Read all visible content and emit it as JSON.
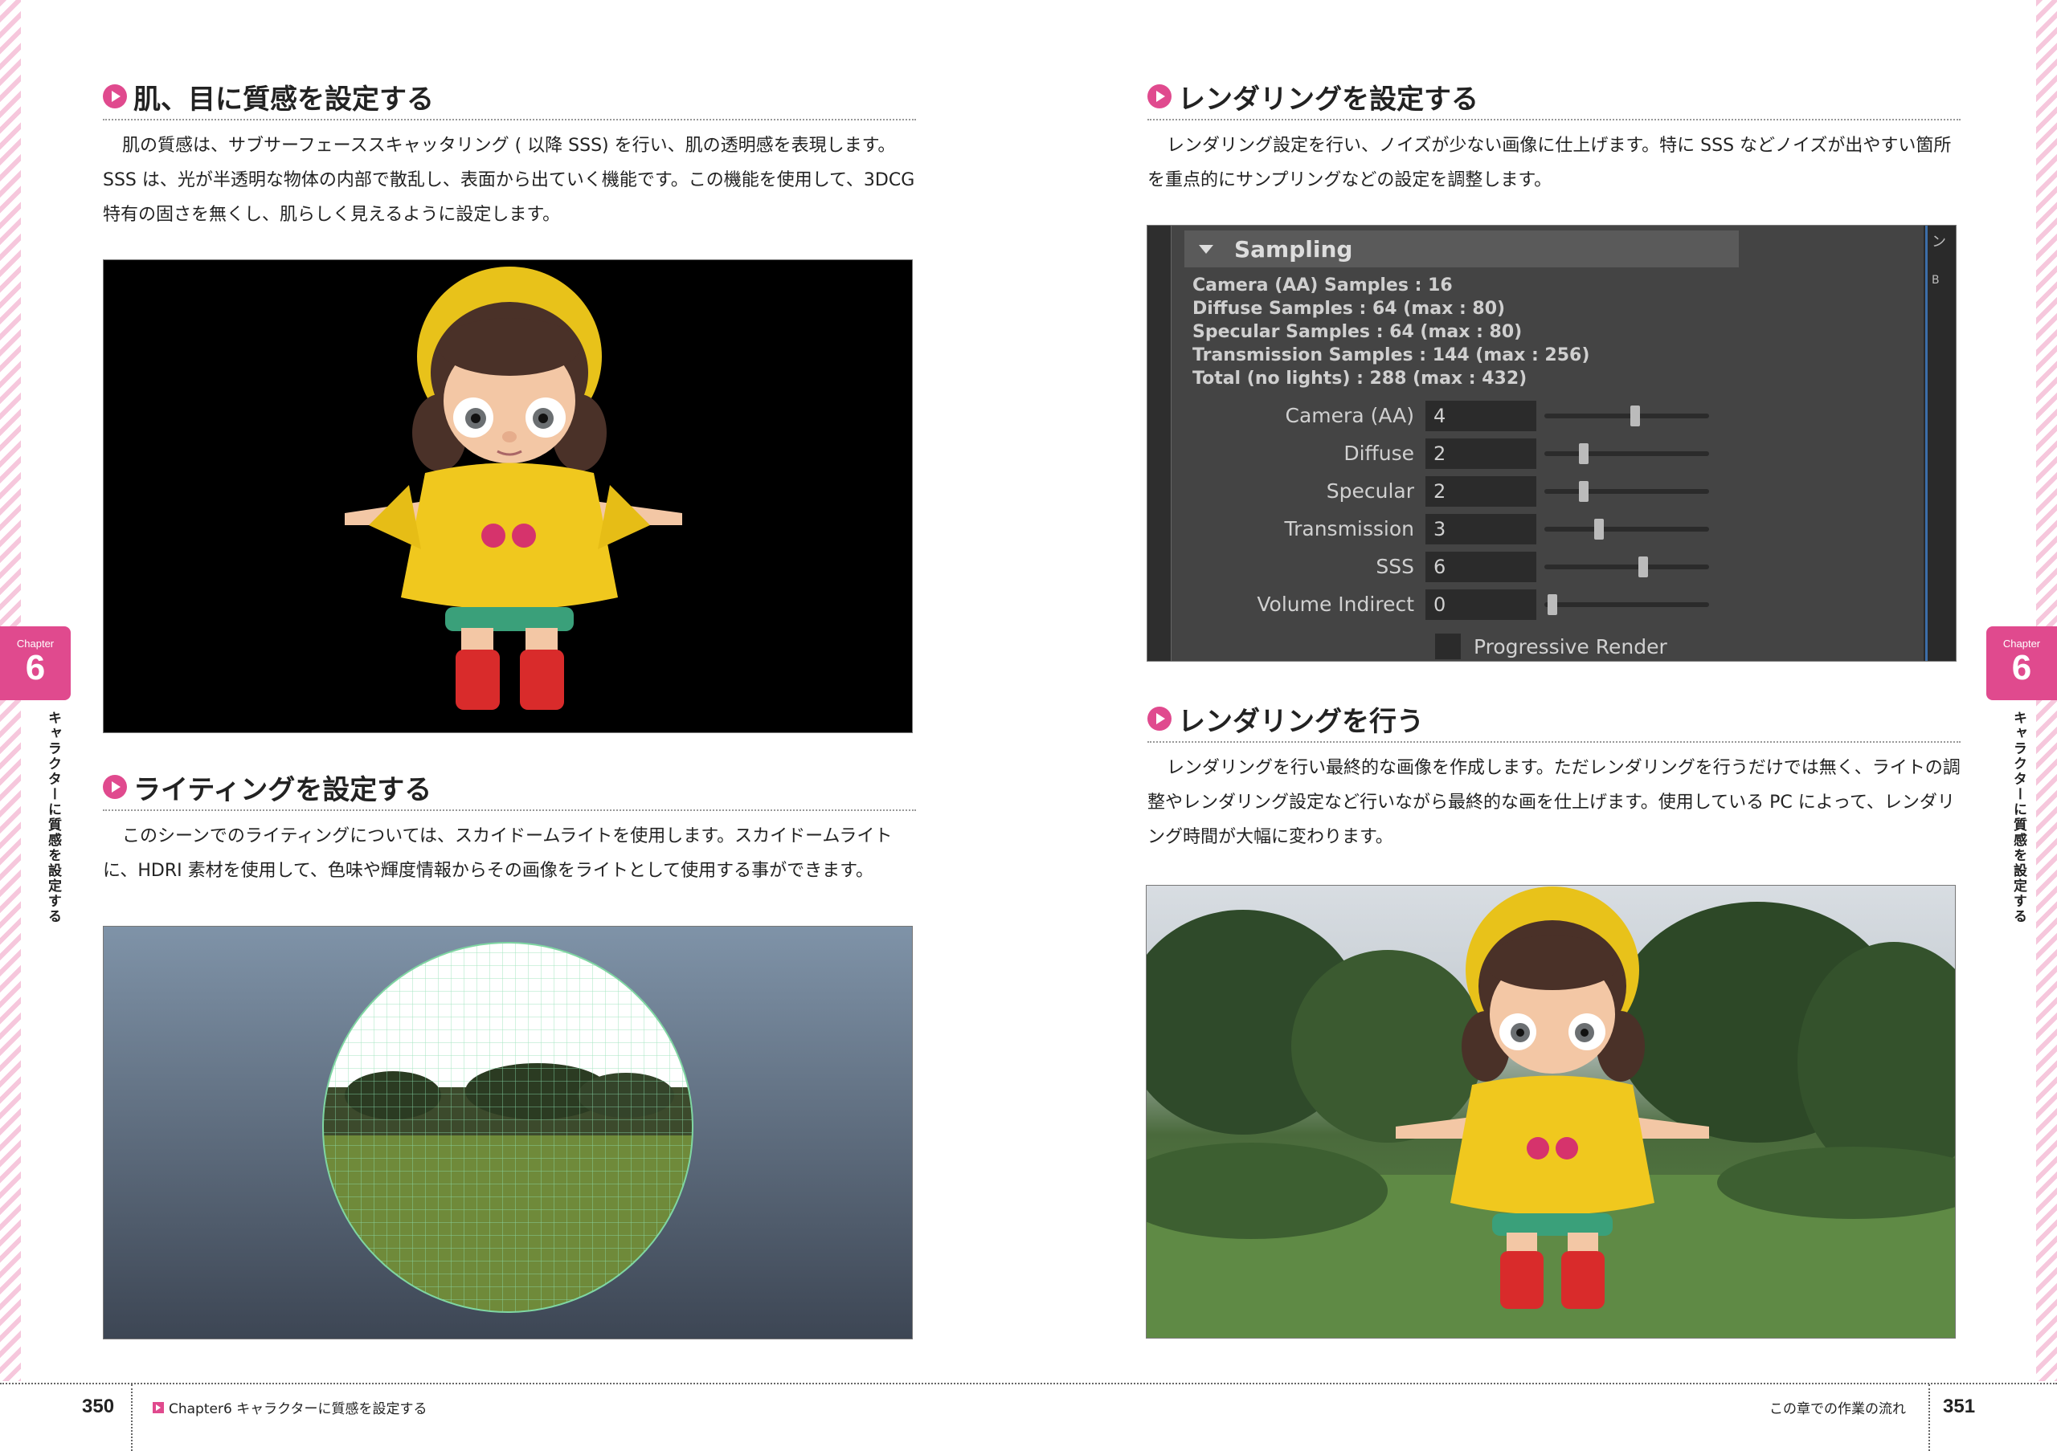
{
  "left_page": {
    "section1": {
      "heading": "肌、目に質感を設定する",
      "body": "肌の質感は、サブサーフェーススキャッタリング ( 以降 SSS) を行い、肌の透明感を表現します。SSS は、光が半透明な物体の内部で散乱し、表面から出ていく機能です。この機能を使用して、3DCG 特有の固さを無くし、肌らしく見えるように設定します。"
    },
    "section2": {
      "heading": "ライティングを設定する",
      "body": "このシーンでのライティングについては、スカイドームライトを使用します。スカイドームライトに、HDRI 素材を使用して、色味や輝度情報からその画像をライトとして使用する事ができます。"
    },
    "page_number": "350",
    "footer_label": "Chapter6 キャラクターに質感を設定する"
  },
  "right_page": {
    "section1": {
      "heading": "レンダリングを設定する",
      "body": "レンダリング設定を行い、ノイズが少ない画像に仕上げます。特に SSS などノイズが出やすい箇所を重点的にサンプリングなどの設定を調整します。"
    },
    "section2": {
      "heading": "レンダリングを行う",
      "body": "レンダリングを行い最終的な画像を作成します。ただレンダリングを行うだけでは無く、ライトの調整やレンダリング設定など行いながら最終的な画を仕上げます。使用している PC によって、レンダリング時間が大幅に変わります。"
    },
    "page_number": "351",
    "footer_label": "この章での作業の流れ"
  },
  "chapter_tab": {
    "word": "Chapter",
    "number": "6",
    "side_title": "キャラクターに質感を設定する"
  },
  "sampling_panel": {
    "title": "Sampling",
    "stats": [
      "Camera (AA) Samples : 16",
      "Diffuse Samples : 64 (max : 80)",
      "Specular Samples : 64 (max : 80)",
      "Transmission Samples : 144 (max : 256)",
      "Total (no lights) : 288 (max : 432)"
    ],
    "rows": [
      {
        "label": "Camera (AA)",
        "value": "4",
        "slider_fraction": 0.55
      },
      {
        "label": "Diffuse",
        "value": "2",
        "slider_fraction": 0.24
      },
      {
        "label": "Specular",
        "value": "2",
        "slider_fraction": 0.24
      },
      {
        "label": "Transmission",
        "value": "3",
        "slider_fraction": 0.33
      },
      {
        "label": "SSS",
        "value": "6",
        "slider_fraction": 0.6
      },
      {
        "label": "Volume Indirect",
        "value": "0",
        "slider_fraction": 0.05
      }
    ],
    "progressive_render_label": "Progressive Render",
    "right_edge_glyph": "ン",
    "right_edge_small": "B"
  },
  "colors": {
    "accent": "#e04a8e",
    "panel_bg": "#444444",
    "field_bg": "#2b2b2b"
  }
}
